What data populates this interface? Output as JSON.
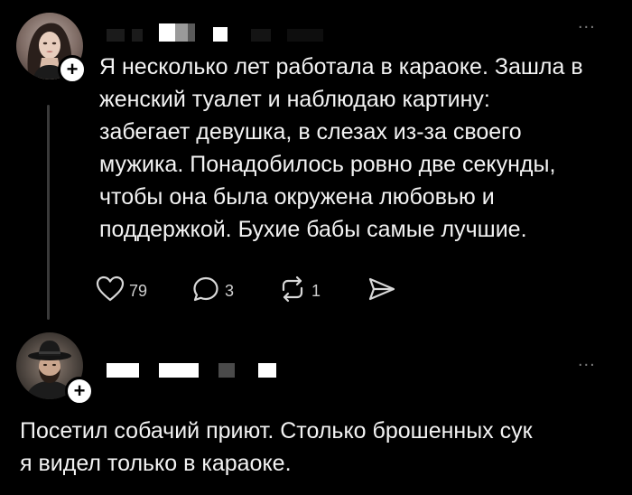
{
  "colors": {
    "background": "#000000",
    "text": "#f3f3f3",
    "muted": "#7a7a7a",
    "thread_line": "#3a3a3a"
  },
  "posts": [
    {
      "avatar_icon": "avatar-woman-icon",
      "menu": "...",
      "text": "Я несколько лет работала в караоке. Зашла в\nженский туалет и наблюдаю картину:\nзабегает девушка, в слезах из-за своего\nмужика. Понадобилось ровно две секунды,\nчтобы она была окружена любовью и\nподдержкой. Бухие бабы самые лучшие.",
      "actions": {
        "likes": "79",
        "replies": "3",
        "reposts": "1"
      },
      "icons": [
        "heart-icon",
        "comment-icon",
        "repost-icon",
        "share-icon"
      ]
    },
    {
      "avatar_icon": "avatar-man-hat-icon",
      "menu": "...",
      "text": "Посетил собачий приют. Столько брошенных сук\nя видел только в караоке."
    }
  ]
}
